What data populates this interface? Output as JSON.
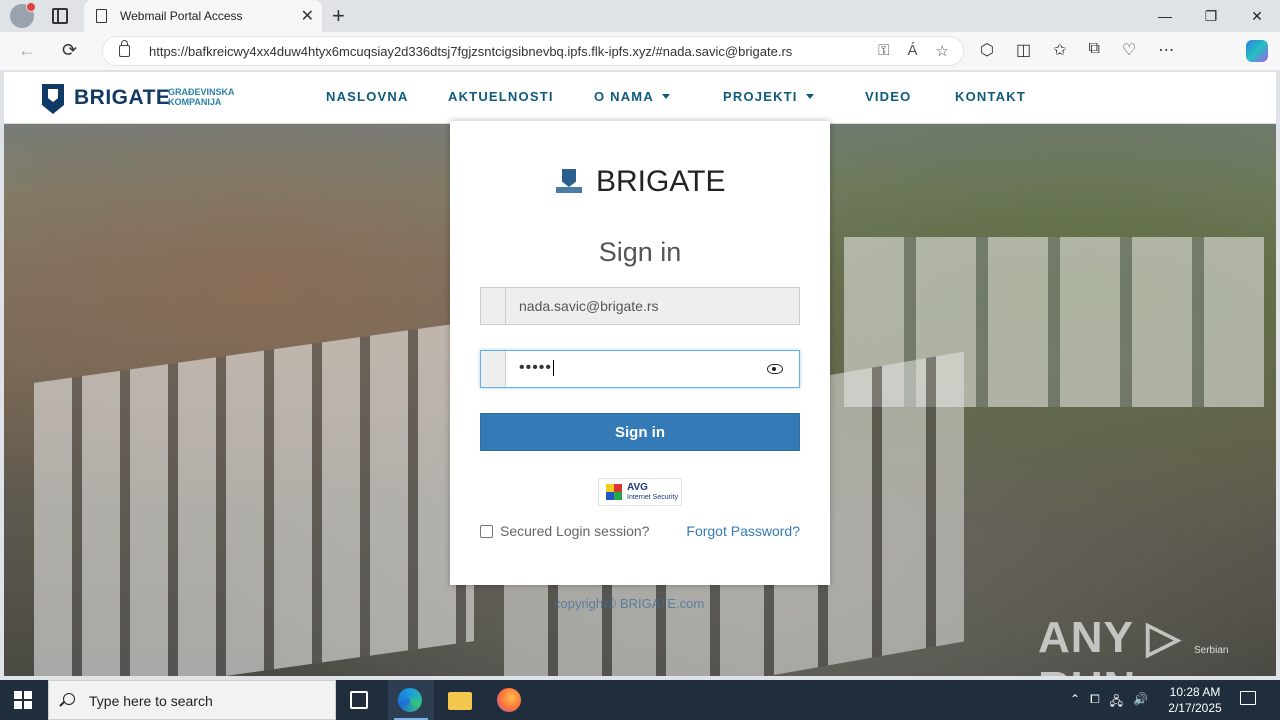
{
  "browser": {
    "tab_title": "Webmail Portal Access",
    "url": "https://bafkreicwy4xx4duw4htyx6mcuqsiay2d336dtsj7fgjzsntcigsibnevbq.ipfs.flk-ipfs.xyz/#nada.savic@brigate.rs",
    "new_tab_symbol": "+",
    "close_symbol": "✕"
  },
  "site": {
    "logo_name": "BRIGATE",
    "logo_sub": "GRAĐEVINSKA KOMPANIJA",
    "nav": [
      {
        "label": "NASLOVNA"
      },
      {
        "label": "AKTUELNOSTI"
      },
      {
        "label": "O NAMA"
      },
      {
        "label": "PROJEKTI"
      },
      {
        "label": "VIDEO"
      },
      {
        "label": "KONTAKT"
      }
    ]
  },
  "login": {
    "brand": "BRIGATE",
    "title": "Sign in",
    "email_value": "nada.savic@brigate.rs",
    "password_mask": "•••••",
    "signin_label": "Sign in",
    "avg_title": "AVG",
    "avg_sub": "Internet Security",
    "secured_label": "Secured Login session?",
    "forgot_label": "Forgot Password?"
  },
  "footer": {
    "copyright": "copyright© BRIGATE.com",
    "watermark": "ANY ▷ RUN",
    "language": "Serbian"
  },
  "taskbar": {
    "search_placeholder": "Type here to search",
    "time": "10:28 AM",
    "date": "2/17/2025"
  },
  "icons": {
    "back": "←",
    "reload": "⟳",
    "minimize": "—",
    "restore": "❐",
    "close": "✕",
    "key": "⚿",
    "read_aloud": "Á",
    "favorite": "☆",
    "extensions": "⬡",
    "split": "◫",
    "favorites_bar": "✩",
    "collections": "⧉",
    "performance": "♡",
    "more": "⋯",
    "tray": [
      "⌃",
      "⧠",
      "🖧",
      "🔊"
    ]
  }
}
